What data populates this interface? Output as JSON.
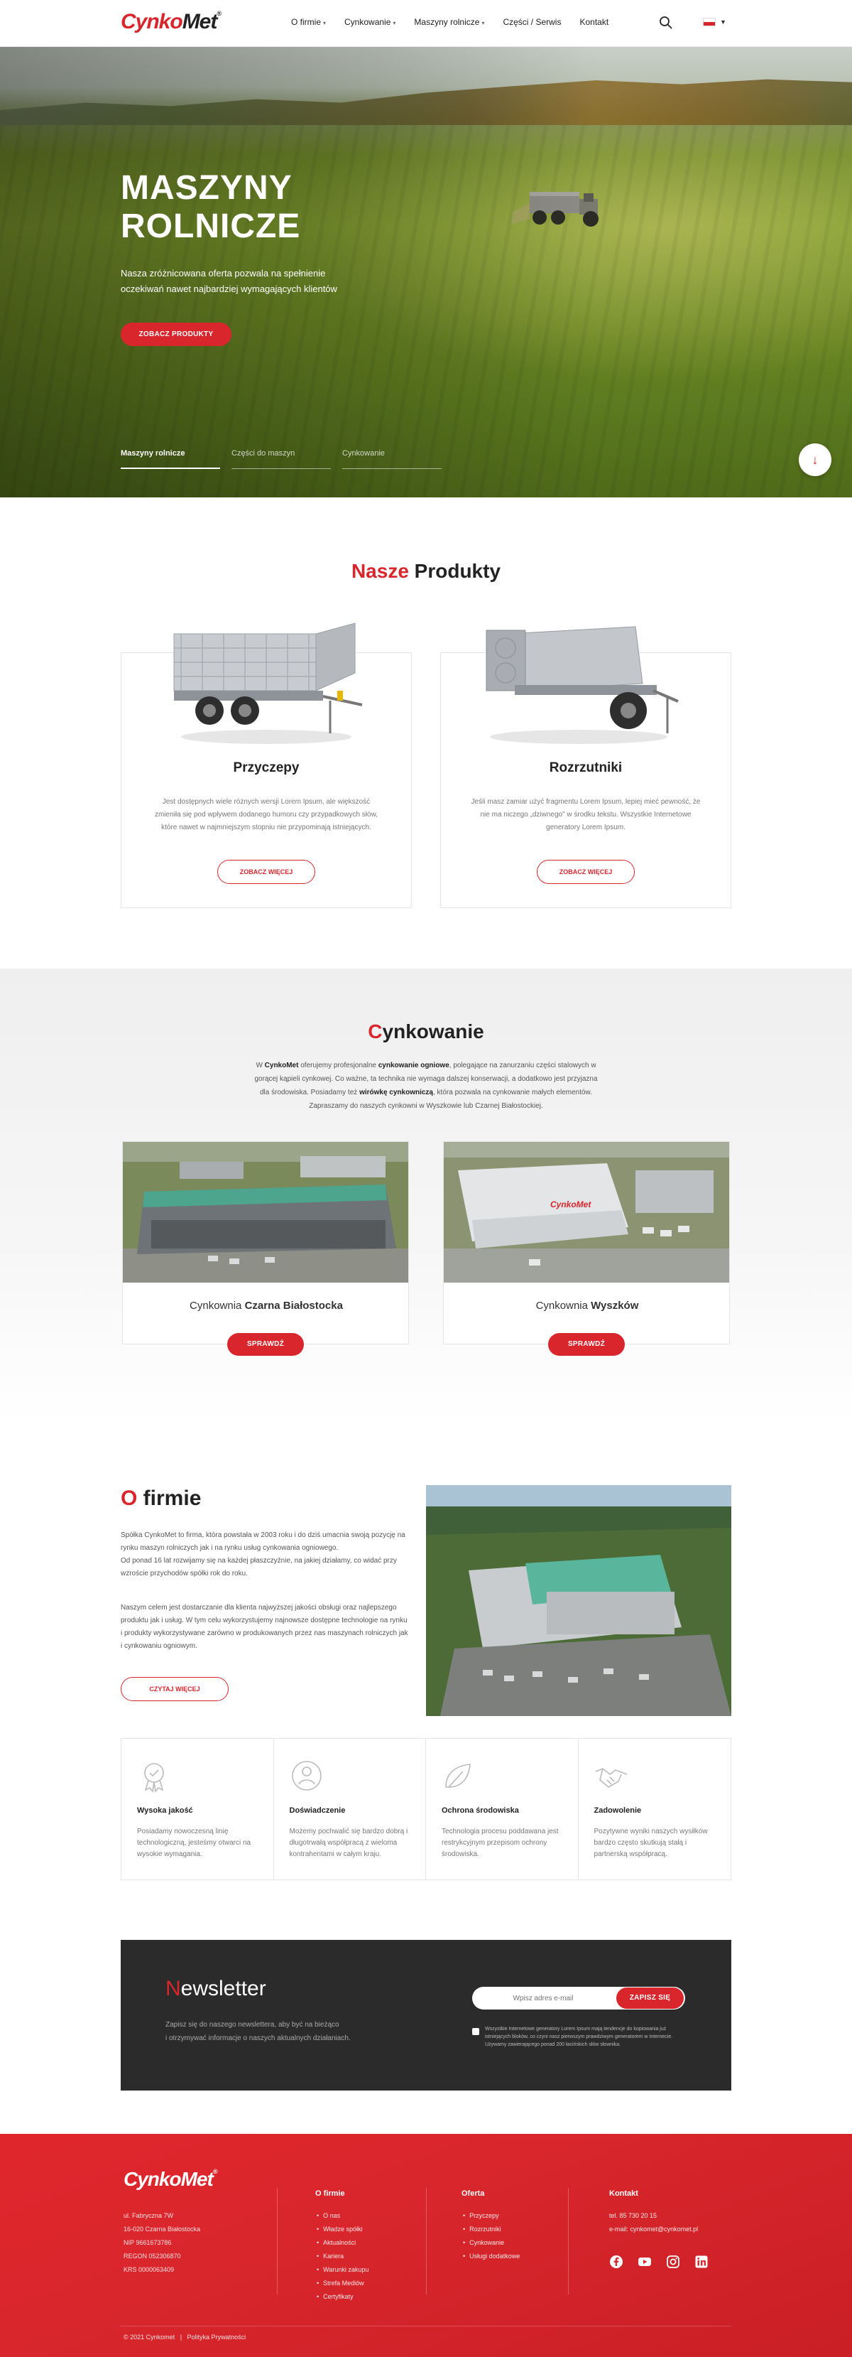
{
  "header": {
    "logo_part1": "Cynko",
    "logo_part2": "Met",
    "logo_reg": "®",
    "nav": [
      {
        "label": "O firmie",
        "has_dropdown": true
      },
      {
        "label": "Cynkowanie",
        "has_dropdown": true
      },
      {
        "label": "Maszyny rolnicze",
        "has_dropdown": true
      },
      {
        "label": "Części / Serwis",
        "has_dropdown": false
      },
      {
        "label": "Kontakt",
        "has_dropdown": false
      }
    ],
    "search_icon": "search-icon",
    "language_flag": "pl-flag",
    "caret": "⌄"
  },
  "hero": {
    "title_line1": "MASZYNY",
    "title_line2": "ROLNICZE",
    "description": "Nasza zróżnicowana oferta pozwala na spełnienie oczekiwań nawet najbardziej wymagających klientów",
    "button": "ZOBACZ PRODUKTY",
    "tabs": [
      "Maszyny rolnicze",
      "Części do maszyn",
      "Cynkowanie"
    ],
    "active_tab": 0,
    "scroll_icon": "↓"
  },
  "products": {
    "title_red": "Nasze",
    "title_rest": " Produkty",
    "items": [
      {
        "name": "Przyczepy",
        "description": "Jest dostępnych wiele różnych wersji Lorem Ipsum, ale większość zmieniła się pod wpływem dodanego humoru czy przypadkowych słów, które nawet w najmniejszym stopniu nie przypominają istniejących.",
        "button": "ZOBACZ WIĘCEJ"
      },
      {
        "name": "Rozrzutniki",
        "description": "Jeśli masz zamiar użyć fragmentu Lorem Ipsum, lepiej mieć pewność, że nie ma niczego „dziwnego\" w środku tekstu. Wszystkie Internetowe generatory Lorem Ipsum.",
        "button": "ZOBACZ WIĘCEJ"
      }
    ]
  },
  "galvanizing": {
    "title_red": "C",
    "title_rest": "ynkowanie",
    "intro_1": "W ",
    "intro_brand": "CynkoMet",
    "intro_2": " oferujemy profesjonalne ",
    "intro_bold1": "cynkowanie ogniowe",
    "intro_3": ", polegające na zanurzaniu części stalowych w gorącej kąpieli cynkowej. Co ważne, ta technika nie wymaga dalszej konserwacji, a dodatkowo jest przyjazna dla środowiska. Posiadamy też ",
    "intro_bold2": "wirówkę cynkowniczą",
    "intro_4": ", która pozwala na cynkowanie małych elementów.",
    "intro_5": "Zapraszamy do naszych cynkowni w Wyszkowie lub Czarnej Białostockiej.",
    "plants": [
      {
        "prefix": "Cynkownia ",
        "name": "Czarna Białostocka",
        "button": "SPRAWDŹ"
      },
      {
        "prefix": "Cynkownia ",
        "name": "Wyszków",
        "button": "SPRAWDŹ"
      }
    ]
  },
  "about": {
    "title_red": "O",
    "title_rest": " firmie",
    "p1": "Spółka CynkoMet to firma, która powstała w 2003 roku i do dziś umacnia swoją pozycję na rynku maszyn rolniczych jak i na rynku usług cynkowania ogniowego.",
    "p2": "Od ponad 16 lat rozwijamy się na każdej płaszczyźnie, na jakiej działamy, co widać przy wzroście przychodów spółki rok do roku.",
    "p3": "Naszym celem jest dostarczanie dla klienta najwyższej jakości obsługi oraz najlepszego produktu jak i usług. W tym celu wykorzystujemy najnowsze dostępne technologie na rynku i produkty wykorzystywane zarówno w produkowanych przez nas maszynach rolniczych jak i cynkowaniu ogniowym.",
    "button": "CZYTAJ WIĘCEJ",
    "features": [
      {
        "icon": "quality-badge-icon",
        "title": "Wysoka jakość",
        "description": "Posiadamy nowoczesną linię technologiczną, jesteśmy otwarci na wysokie wymagania."
      },
      {
        "icon": "experience-icon",
        "title": "Doświadczenie",
        "description": "Możemy pochwalić się bardzo dobrą i długotrwałą współpracą z wieloma kontrahentami w całym kraju."
      },
      {
        "icon": "environment-icon",
        "title": "Ochrona środowiska",
        "description": "Technologia procesu poddawana jest restrykcyjnym przepisom ochrony środowiska."
      },
      {
        "icon": "handshake-icon",
        "title": "Zadowolenie",
        "description": "Pozytywne wyniki naszych wysiłków bardzo często skutkują stałą i partnerską współpracą."
      }
    ]
  },
  "newsletter": {
    "title_red": "N",
    "title_rest": "ewsletter",
    "desc_line1": "Zapisz się do naszego newslettera, aby być na bieżąco",
    "desc_line2": "i otrzymywać informacje o naszych aktualnych działaniach.",
    "placeholder": "Wpisz adres e-mail",
    "button": "ZAPISZ SIĘ",
    "consent": "Wszystkie Internetowe generatory Lorem Ipsum mają tendencje do kopiowania już istniejących bloków, co czyni nasz pierwszym prawdziwym generatorem w Internecie. Używamy zawierającego ponad 200 łacińskich słów słownika."
  },
  "footer": {
    "logo": "CynkoMet",
    "logo_reg": "®",
    "address": [
      "ul. Fabryczna 7W",
      "16-020 Czarna Białostocka",
      "NIP 9661673786",
      "REGON 052306870",
      "KRS 0000063409"
    ],
    "col1_title": "O firmie",
    "col1_items": [
      "O nas",
      "Władze spółki",
      "Aktualności",
      "Kariera",
      "Warunki zakupu",
      "Strefa Mediów",
      "Certyfikaty"
    ],
    "col2_title": "Oferta",
    "col2_items": [
      "Przyczepy",
      "Rozrzutniki",
      "Cynkowanie",
      "Usługi dodatkowe"
    ],
    "col3_title": "Kontakt",
    "phone": "tel. 85 730 20 15",
    "email": "e-mail: cynkomet@cynkomet.pl",
    "social": [
      "facebook-icon",
      "youtube-icon",
      "instagram-icon",
      "linkedin-icon"
    ],
    "copyright": "© 2021 Cynkomet",
    "separator": "|",
    "privacy": "Polityka Prywatności"
  },
  "colors": {
    "accent": "#d8262c",
    "dark": "#2b2b2b"
  }
}
